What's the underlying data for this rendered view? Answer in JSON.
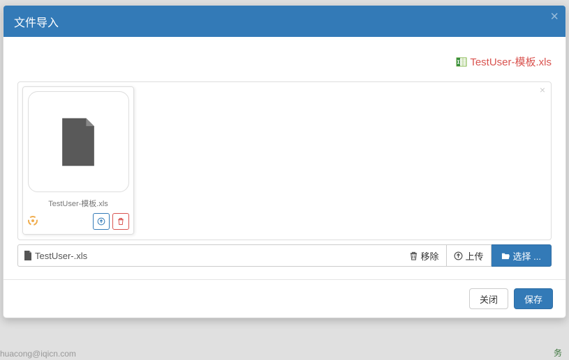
{
  "modal": {
    "title": "文件导入",
    "template_link": "TestUser-模板.xls"
  },
  "file_tile": {
    "name": "TestUser-模板.xls"
  },
  "filename_input": {
    "value": "TestUser-.xls"
  },
  "buttons": {
    "remove": "移除",
    "upload": "上传",
    "select": "选择 ...",
    "close": "关闭",
    "save": "保存"
  },
  "background": {
    "text_left": "huacong@iqicn.com",
    "text_right": "务"
  }
}
